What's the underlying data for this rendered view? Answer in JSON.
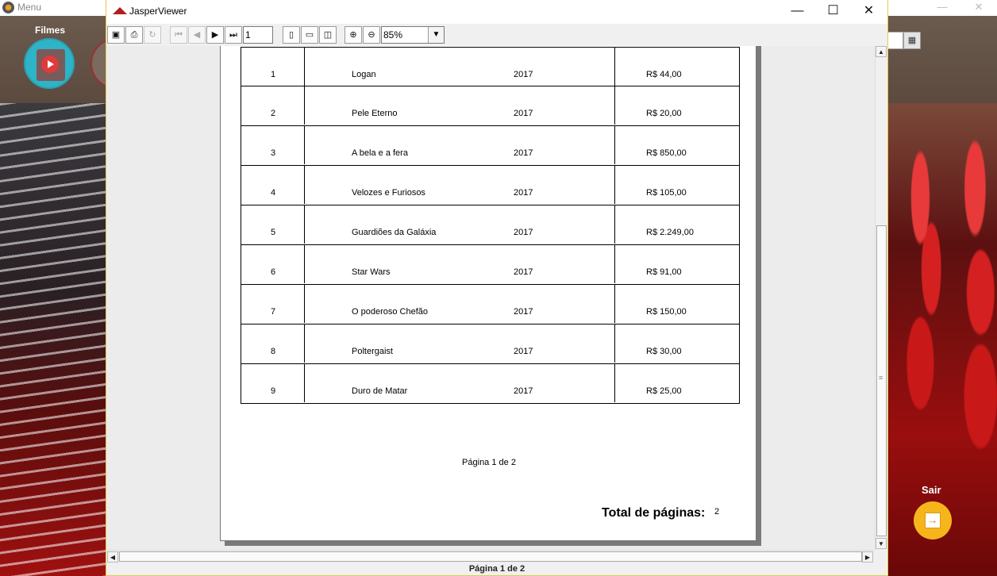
{
  "background_app": {
    "title": "Menu",
    "filmes_label": "Filmes",
    "sair_label": "Sair",
    "icons": {
      "app": "menu-app-icon",
      "filmes": "film-play-icon",
      "calendar": "calendar-icon",
      "sair": "exit-arrow-icon"
    }
  },
  "viewer": {
    "title": "JasperViewer",
    "window_controls": {
      "minimize": "—",
      "maximize": "☐",
      "close": "✕"
    },
    "toolbar": {
      "page_input": "1",
      "zoom_value": "85%",
      "icons": [
        "save-icon",
        "print-icon",
        "reload-icon",
        "first-page-icon",
        "previous-page-icon",
        "next-page-icon",
        "last-page-icon",
        "actual-size-icon",
        "fit-page-icon",
        "fit-width-icon",
        "zoom-in-icon",
        "zoom-out-icon"
      ]
    },
    "status": "Página 1 de 2"
  },
  "report": {
    "rows": [
      {
        "num": "1",
        "title": "Logan",
        "year": "2017",
        "price": "R$ 44,00"
      },
      {
        "num": "2",
        "title": "Pele Eterno",
        "year": "2017",
        "price": "R$ 20,00"
      },
      {
        "num": "3",
        "title": "A bela e a fera",
        "year": "2017",
        "price": "R$ 850,00"
      },
      {
        "num": "4",
        "title": "Velozes e Furiosos",
        "year": "2017",
        "price": "R$ 105,00"
      },
      {
        "num": "5",
        "title": "Guardiões da Galáxia",
        "year": "2017",
        "price": "R$ 2.249,00"
      },
      {
        "num": "6",
        "title": "Star Wars",
        "year": "2017",
        "price": "R$ 91,00"
      },
      {
        "num": "7",
        "title": "O poderoso Chefão",
        "year": "2017",
        "price": "R$ 150,00"
      },
      {
        "num": "8",
        "title": "Poltergaist",
        "year": "2017",
        "price": "R$ 30,00"
      },
      {
        "num": "9",
        "title": "Duro de Matar",
        "year": "2017",
        "price": "R$ 25,00"
      }
    ],
    "page_footer": "Página 1 de  2",
    "total_label": "Total de páginas:",
    "total_value": "2"
  },
  "colors": {
    "accent_yellow": "#f7b51c",
    "filmes_teal": "#2eb3c7",
    "jasper_red": "#b01e1e"
  }
}
